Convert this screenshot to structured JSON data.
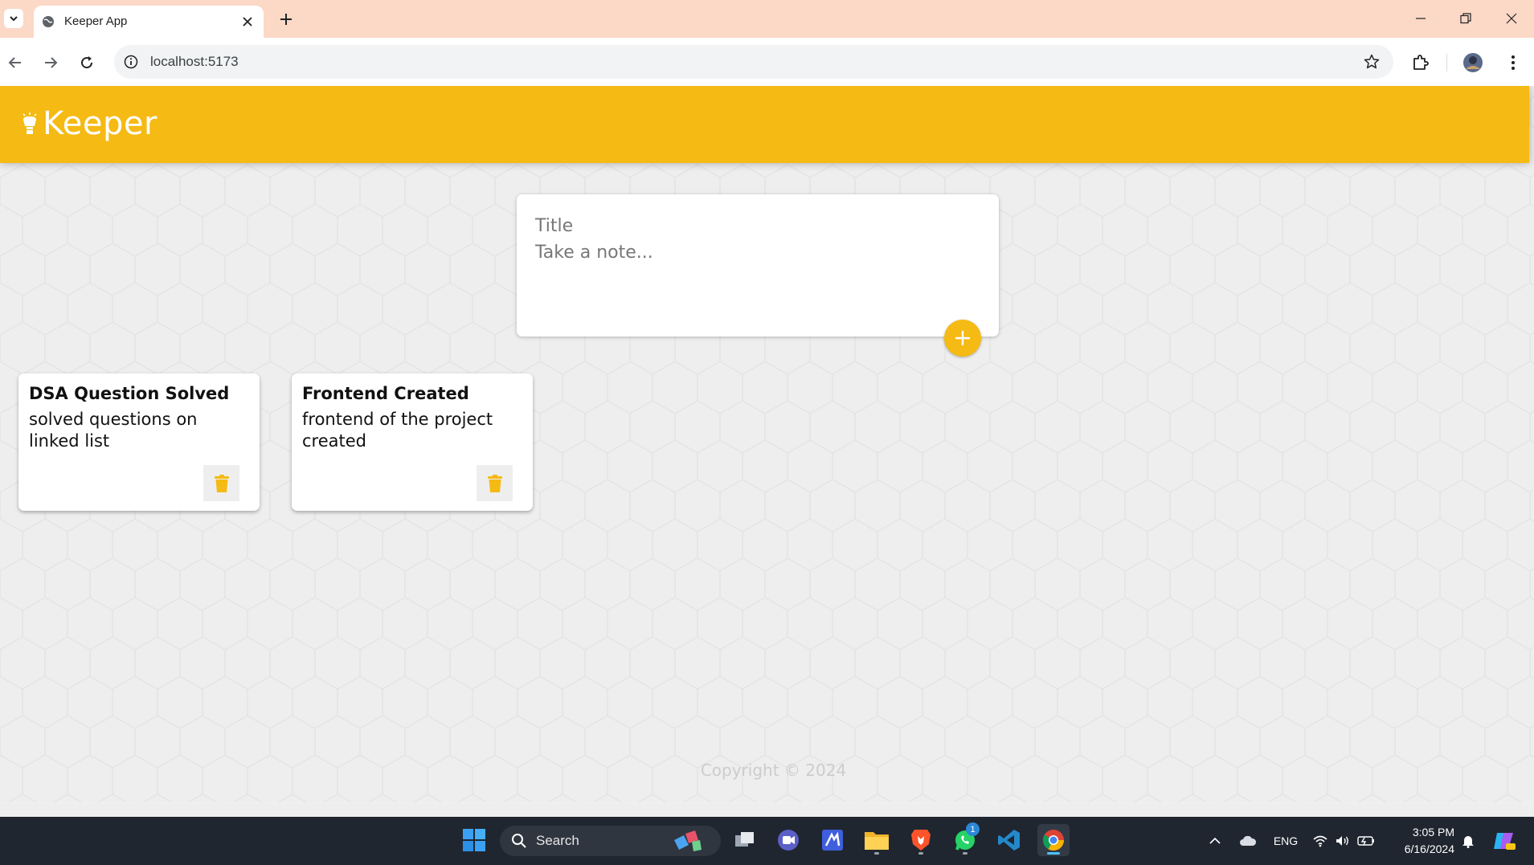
{
  "browser": {
    "tab_title": "Keeper App",
    "url": "localhost:5173"
  },
  "app": {
    "brand": "Keeper",
    "accent_color": "#f5ba13",
    "create_note": {
      "title_placeholder": "Title",
      "content_placeholder": "Take a note...",
      "title_value": "",
      "content_value": "",
      "add_icon": "plus-icon"
    },
    "notes": [
      {
        "title": "DSA Question Solved",
        "content": "solved questions on linked list",
        "delete_icon": "trash-icon"
      },
      {
        "title": "Frontend Created",
        "content": "frontend of the project created",
        "delete_icon": "trash-icon"
      }
    ],
    "footer": "Copyright © 2024"
  },
  "taskbar": {
    "search_label": "Search",
    "whatsapp_badge": "1",
    "language": "ENG",
    "time": "3:05 PM",
    "date": "6/16/2024"
  }
}
